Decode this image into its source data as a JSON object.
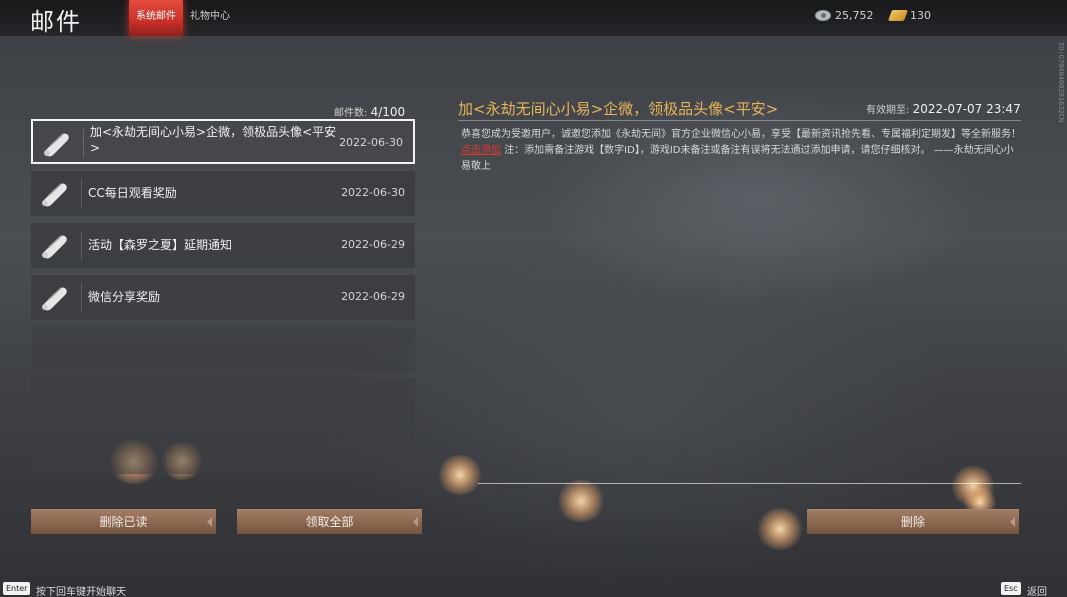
{
  "header": {
    "title": "邮件",
    "tabs": [
      {
        "label": "系统邮件",
        "active": true
      },
      {
        "label": "礼物中心",
        "active": false
      }
    ],
    "currency": {
      "silver": {
        "icon": "coin-icon",
        "value": "25,752"
      },
      "gold": {
        "icon": "gold-bar-icon",
        "value": "130"
      }
    }
  },
  "side_id": "ID:G7040400281632CN",
  "mail_list": {
    "count_label": "邮件数:",
    "count_value": "4/100",
    "items": [
      {
        "title_line1": "加<永劫无间心小易>企微，领极品头像<平安",
        "title_line2": ">",
        "date": "2022-06-30",
        "selected": true
      },
      {
        "title": "CC每日观看奖励",
        "date": "2022-06-30"
      },
      {
        "title": "活动【森罗之夏】延期通知",
        "date": "2022-06-29"
      },
      {
        "title": "微信分享奖励",
        "date": "2022-06-29"
      }
    ],
    "delete_read_label": "删除已读",
    "claim_all_label": "领取全部"
  },
  "detail": {
    "title": "加<永劫无间心小易>企微，领极品头像<平安>",
    "expiry_label": "有效期至:",
    "expiry_value": "2022-07-07 23:47",
    "body_part1": "恭喜您成为受邀用户，诚邀您添加《永劫无间》官方企业微信心小易，享受【最新资讯抢先看、专属福利定期发】等全新服务！",
    "body_link": "点击添加",
    "body_part2": "注：添加需备注游戏【数字ID】，游戏ID未备注或备注有误将无法通过添加申请，请您仔细核对。 ——永劫无间心小易敬上",
    "delete_label": "删除"
  },
  "footer": {
    "enter_key": "Enter",
    "enter_hint": "按下回车键开始聊天",
    "esc_key": "Esc",
    "esc_hint": "返回"
  },
  "colors": {
    "accent_red": "#c9302a",
    "title_gold": "#e8b45a",
    "link_red": "#e0372c",
    "button_brown": "#8a6650"
  }
}
